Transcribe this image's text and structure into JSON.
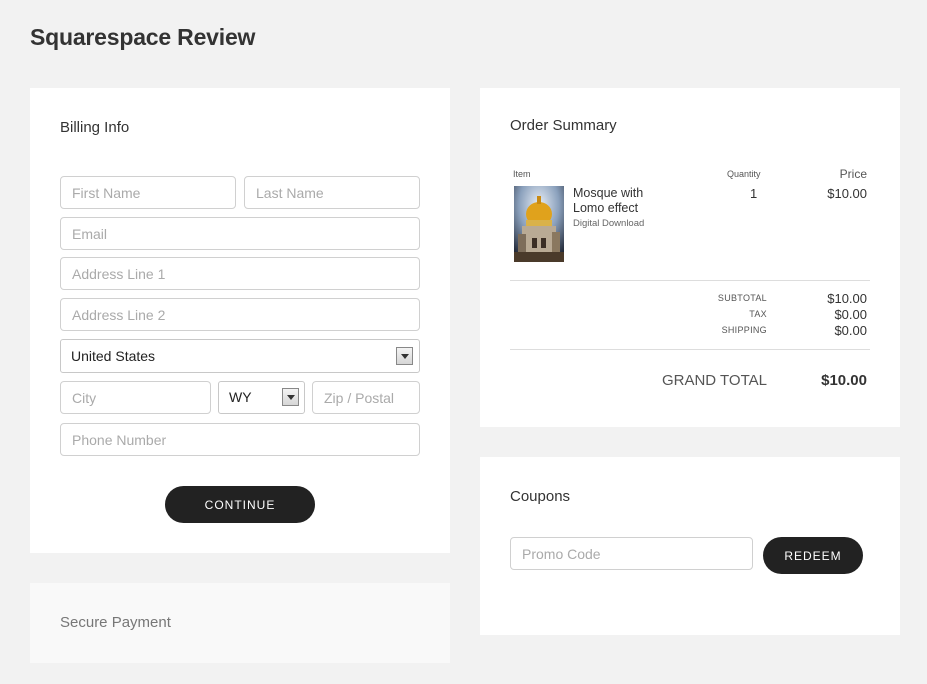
{
  "page": {
    "title": "Squarespace Review"
  },
  "billing": {
    "title": "Billing Info",
    "first_name_placeholder": "First Name",
    "last_name_placeholder": "Last Name",
    "email_placeholder": "Email",
    "address1_placeholder": "Address Line 1",
    "address2_placeholder": "Address Line 2",
    "country_value": "United States",
    "city_placeholder": "City",
    "state_value": "WY",
    "zip_placeholder": "Zip / Postal",
    "phone_placeholder": "Phone Number",
    "continue_label": "CONTINUE"
  },
  "secure": {
    "title": "Secure Payment"
  },
  "order": {
    "title": "Order Summary",
    "col_item": "Item",
    "col_quantity": "Quantity",
    "col_price": "Price",
    "item_name": "Mosque with Lomo effect",
    "item_type": "Digital Download",
    "item_quantity": "1",
    "item_price": "$10.00",
    "subtotal_label": "SUBTOTAL",
    "subtotal_value": "$10.00",
    "tax_label": "TAX",
    "tax_value": "$0.00",
    "shipping_label": "SHIPPING",
    "shipping_value": "$0.00",
    "grand_total_label": "GRAND TOTAL",
    "grand_total_value": "$10.00"
  },
  "coupons": {
    "title": "Coupons",
    "promo_placeholder": "Promo Code",
    "redeem_label": "REDEEM"
  },
  "colors": {
    "background": "#f2f2f2",
    "panel": "#ffffff",
    "button": "#222222"
  },
  "icons": {
    "select_arrow": "chevron-down-icon",
    "item_image": "mosque-photo"
  }
}
